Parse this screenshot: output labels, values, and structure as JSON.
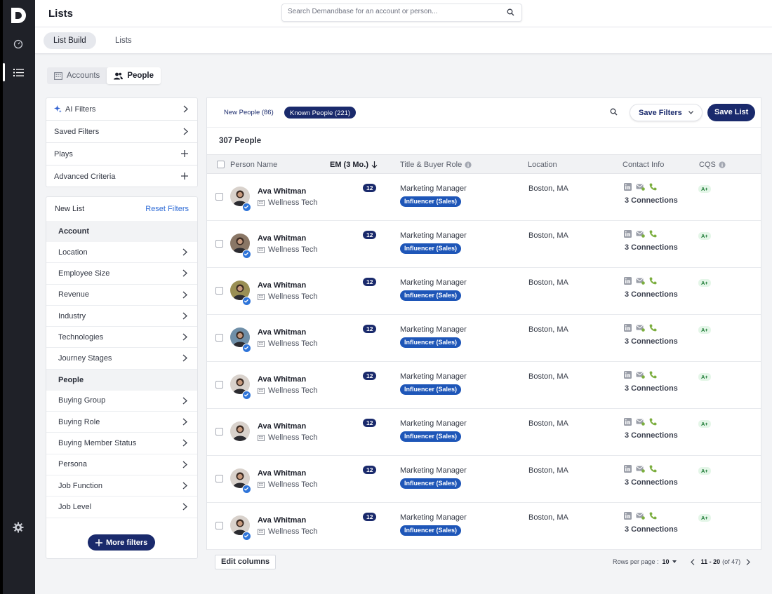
{
  "colors": {
    "rail": "#1f2128",
    "navy": "#1a2a6c",
    "role_blue": "#1e56b8",
    "link": "#2e6bd6",
    "cqs_green": "#1c7a34"
  },
  "rail": {
    "logo": "D",
    "icons": [
      "dashboard-icon",
      "list-icon",
      "settings-gear-icon"
    ]
  },
  "header": {
    "title": "Lists",
    "search_placeholder": "Search Demandbase for an account or person..."
  },
  "subtabs": [
    "List Build",
    "Lists"
  ],
  "toggle": [
    "Accounts",
    "People"
  ],
  "filters_top": [
    {
      "label": "AI Filters",
      "trail": "chevron"
    },
    {
      "label": "Saved Filters",
      "trail": "chevron"
    },
    {
      "label": "Plays",
      "trail": "plus"
    },
    {
      "label": "Advanced Criteria",
      "trail": "plus"
    }
  ],
  "criteria": {
    "title": "New List",
    "reset": "Reset Filters",
    "account_section": "Account",
    "account_items": [
      "Location",
      "Employee Size",
      "Revenue",
      "Industry",
      "Technologies",
      "Journey Stages"
    ],
    "people_section": "People",
    "people_items": [
      "Buying Group",
      "Buying Role",
      "Buying Member Status",
      "Persona",
      "Job Function",
      "Job Level"
    ],
    "more_filters": "More filters"
  },
  "results": {
    "chip_new": "New People (86)",
    "chip_known": "Known People (221)",
    "save_filters": "Save Filters",
    "save_list": "Save List",
    "count": "307 People",
    "columns": [
      "Person Name",
      "EM (3 Mo.)",
      "Title & Buyer Role",
      "Location",
      "Contact Info",
      "CQS"
    ],
    "rows": [
      {
        "name": "Ava Whitman",
        "company": "Wellness Tech",
        "em": "12",
        "title": "Marketing Manager",
        "role": "Influencer (Sales)",
        "location": "Boston, MA",
        "connections": "3 Connections",
        "cqs": "A+",
        "avatar_bg": "#d9d2cc",
        "verified": true
      },
      {
        "name": "Ava Whitman",
        "company": "Wellness Tech",
        "em": "12",
        "title": "Marketing Manager",
        "role": "Influencer (Sales)",
        "location": "Boston, MA",
        "connections": "3 Connections",
        "cqs": "A+",
        "avatar_bg": "#8a7766",
        "verified": true
      },
      {
        "name": "Ava Whitman",
        "company": "Wellness Tech",
        "em": "12",
        "title": "Marketing Manager",
        "role": "Influencer (Sales)",
        "location": "Boston, MA",
        "connections": "3 Connections",
        "cqs": "A+",
        "avatar_bg": "#9a8f54",
        "verified": true
      },
      {
        "name": "Ava Whitman",
        "company": "Wellness Tech",
        "em": "12",
        "title": "Marketing Manager",
        "role": "Influencer (Sales)",
        "location": "Boston, MA",
        "connections": "3 Connections",
        "cqs": "A+",
        "avatar_bg": "#6f8fa8",
        "verified": true
      },
      {
        "name": "Ava Whitman",
        "company": "Wellness Tech",
        "em": "12",
        "title": "Marketing Manager",
        "role": "Influencer (Sales)",
        "location": "Boston, MA",
        "connections": "3 Connections",
        "cqs": "A+",
        "avatar_bg": "#d9d2cc",
        "verified": true
      },
      {
        "name": "Ava Whitman",
        "company": "Wellness Tech",
        "em": "12",
        "title": "Marketing Manager",
        "role": "Influencer (Sales)",
        "location": "Boston, MA",
        "connections": "3 Connections",
        "cqs": "A+",
        "avatar_bg": "#d9d2cc",
        "verified": false
      },
      {
        "name": "Ava Whitman",
        "company": "Wellness Tech",
        "em": "12",
        "title": "Marketing Manager",
        "role": "Influencer (Sales)",
        "location": "Boston, MA",
        "connections": "3 Connections",
        "cqs": "A+",
        "avatar_bg": "#d9d2cc",
        "verified": true
      },
      {
        "name": "Ava Whitman",
        "company": "Wellness Tech",
        "em": "12",
        "title": "Marketing Manager",
        "role": "Influencer (Sales)",
        "location": "Boston, MA",
        "connections": "3 Connections",
        "cqs": "A+",
        "avatar_bg": "#d9d2cc",
        "verified": true
      }
    ]
  },
  "footer": {
    "edit_columns": "Edit columns",
    "rows_per_page_label": "Rows per page :",
    "rows_per_page": "10",
    "range": "11 - 20",
    "of_total": "(of 47)"
  }
}
